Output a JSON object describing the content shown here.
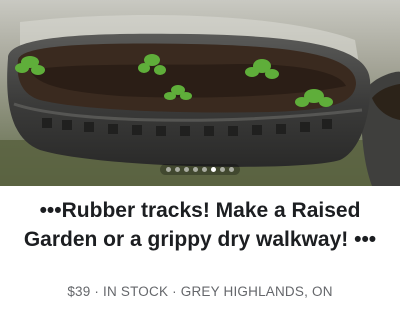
{
  "listing": {
    "title": "•••Rubber tracks! Make a Raised Garden or a grippy dry walkway! •••",
    "meta": "$39 · IN STOCK · GREY HIGHLANDS, ON",
    "photo_count": 8,
    "active_photo": 5
  },
  "colors": {
    "title": "#1c1e21",
    "meta": "#65676b"
  }
}
